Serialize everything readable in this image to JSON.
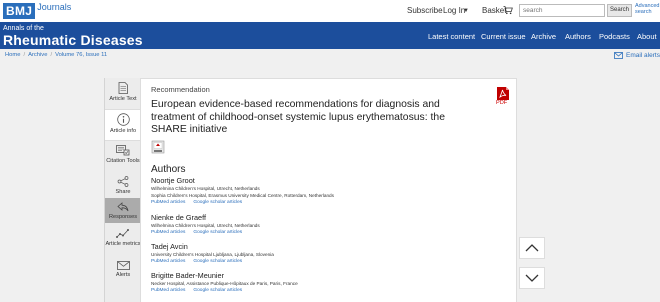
{
  "brand": {
    "logo_text": "BMJ",
    "journals_text": "Journals"
  },
  "header": {
    "subscribe": "Subscribe",
    "login": "Log In",
    "basket": "Basket",
    "search_placeholder": "search",
    "search_button": "Search",
    "advanced_search": "Advanced search"
  },
  "journal": {
    "small_title": "Annals of the",
    "big_title": "Rheumatic Diseases",
    "nav": [
      "Latest content",
      "Current issue",
      "Archive",
      "Authors",
      "Podcasts",
      "About"
    ]
  },
  "breadcrumb": [
    "Home",
    "Archive",
    "Volume 76, Issue 11"
  ],
  "email_alerts": "Email alerts",
  "tools": [
    {
      "label": "Article Text",
      "icon": "article-text-icon"
    },
    {
      "label": "Article info",
      "icon": "info-icon"
    },
    {
      "label": "Citation Tools",
      "icon": "citation-icon"
    },
    {
      "label": "Share",
      "icon": "share-icon"
    },
    {
      "label": "Responses",
      "icon": "reply-icon"
    },
    {
      "label": "Article metrics",
      "icon": "metrics-icon"
    },
    {
      "label": "Alerts",
      "icon": "envelope-icon"
    }
  ],
  "article": {
    "type": "Recommendation",
    "title": "European evidence-based recommendations for diagnosis and treatment of childhood-onset systemic lupus erythematosus: the SHARE initiative",
    "pdf_label": "PDF",
    "authors_heading": "Authors",
    "authors": [
      {
        "name": "Noortje Groot",
        "affiliations": [
          "Wilhelmina Children's Hospital, Utrecht, Netherlands",
          "Sophia Children's Hospital, Erasmus University Medical Centre, Rotterdam, Netherlands"
        ]
      },
      {
        "name": "Nienke de Graeff",
        "affiliations": [
          "Wilhelmina Children's Hospital, Utrecht, Netherlands"
        ]
      },
      {
        "name": "Tadej Avcin",
        "affiliations": [
          "University Children's Hospital Ljubljana, Ljubljana, Slovenia"
        ]
      },
      {
        "name": "Brigitte Bader-Meunier",
        "affiliations": [
          "Necker Hospital, Assistance Publique-Hôpitaux de Paris, Paris, France"
        ]
      }
    ],
    "pubmed_label": "PubMed articles",
    "scholar_label": "Google scholar articles"
  },
  "colors": {
    "brand_blue": "#1c4e9c",
    "link_blue": "#2a6ebb",
    "pdf_red": "#c00000"
  }
}
